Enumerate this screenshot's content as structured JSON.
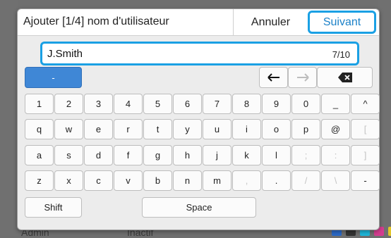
{
  "dialog": {
    "title": "Ajouter [1/4] nom d'utilisateur",
    "cancel_label": "Annuler",
    "next_label": "Suivant"
  },
  "input": {
    "value": "J.Smith",
    "counter": "7/10"
  },
  "keyboard": {
    "mode_label": "-",
    "row1": [
      "1",
      "2",
      "3",
      "4",
      "5",
      "6",
      "7",
      "8",
      "9",
      "0",
      "_",
      "^"
    ],
    "row2": [
      "q",
      "w",
      "e",
      "r",
      "t",
      "y",
      "u",
      "i",
      "o",
      "p",
      "@",
      "["
    ],
    "row3": [
      "a",
      "s",
      "d",
      "f",
      "g",
      "h",
      "j",
      "k",
      "l",
      ";",
      ":",
      "]"
    ],
    "row4": [
      "z",
      "x",
      "c",
      "v",
      "b",
      "n",
      "m",
      ",",
      ".",
      "/",
      "\\",
      "-"
    ],
    "shift_label": "Shift",
    "space_label": "Space"
  },
  "background": {
    "bottom_left_text": "Admin",
    "bottom_mid_text": "Inactif"
  },
  "icons": {
    "left": "arrow-left-icon",
    "right": "arrow-right-icon",
    "backspace": "backspace-icon"
  },
  "colors": {
    "accent": "#1aa0e4",
    "mode_key": "#3f87d6"
  }
}
